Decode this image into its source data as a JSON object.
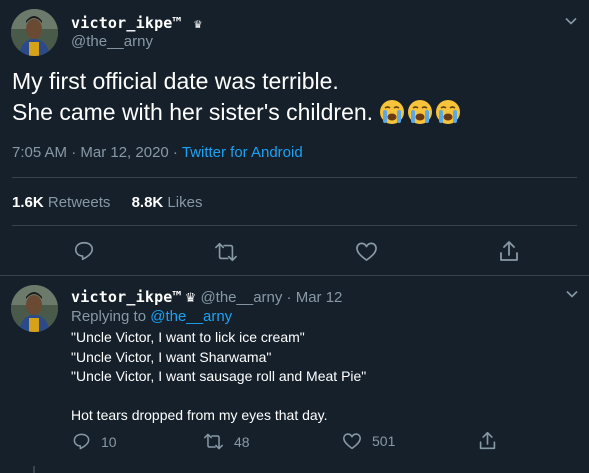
{
  "main_tweet": {
    "display_name": "victor_ikpe™",
    "crown_glyph": "♛",
    "handle": "@the__arny",
    "text_line1": "My first official date was terrible.",
    "text_line2": "She came with her sister's children.",
    "emoji": [
      "crying-face-emoji",
      "crying-face-emoji",
      "crying-face-emoji"
    ],
    "timestamp": "7:05 AM · Mar 12, 2020 · ",
    "source": "Twitter for Android",
    "retweets_count": "1.6K",
    "retweets_label": "Retweets",
    "likes_count": "8.8K",
    "likes_label": "Likes"
  },
  "reply": {
    "display_name": "victor_ikpe™",
    "crown_glyph": "♛",
    "handle_date": "@the__arny · Mar 12",
    "replying_prefix": "Replying to ",
    "replying_handle": "@the__arny",
    "lines": [
      "\"Uncle Victor, I want to lick ice cream\"",
      "\"Uncle Victor, I want Sharwama\"",
      "\"Uncle Victor, I want sausage roll and Meat Pie\""
    ],
    "closing_line": "Hot tears dropped from my eyes that day.",
    "reply_count": "10",
    "retweet_count": "48",
    "like_count": "501"
  },
  "colors": {
    "background": "#15202b",
    "muted": "#8899a6",
    "link": "#1da1f2",
    "divider": "#38444d"
  }
}
